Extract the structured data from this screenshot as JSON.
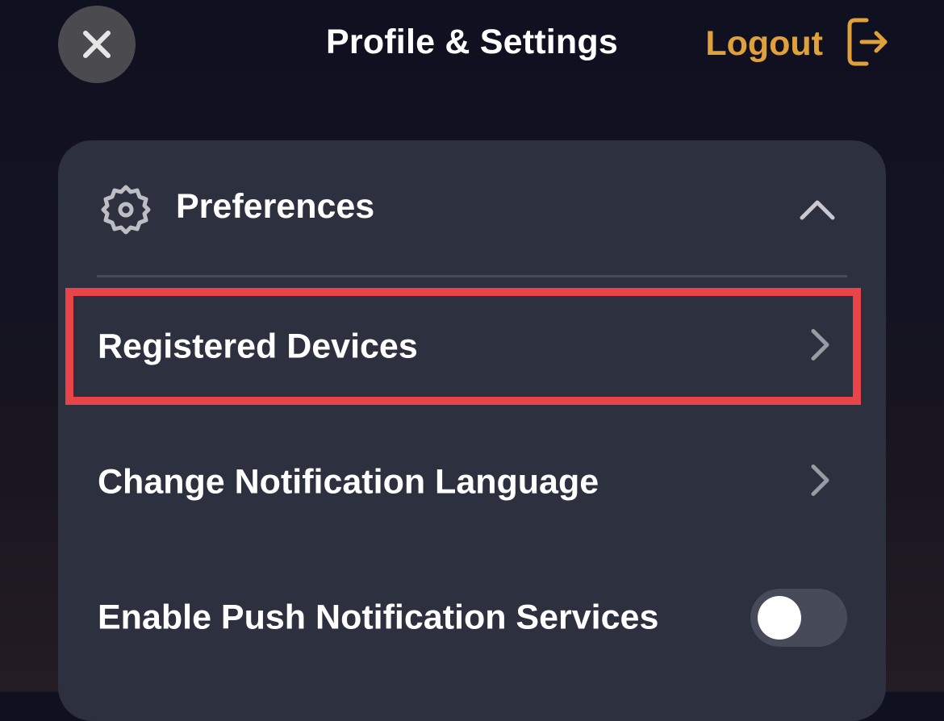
{
  "header": {
    "title": "Profile & Settings",
    "close_icon": "close-icon",
    "logout_label": "Logout",
    "logout_icon": "logout-icon"
  },
  "preferences": {
    "title": "Preferences",
    "icon": "gear-icon",
    "expanded": true,
    "items": [
      {
        "label": "Registered Devices",
        "type": "link",
        "highlighted": true
      },
      {
        "label": "Change Notification Language",
        "type": "link"
      },
      {
        "label": "Enable Push Notification Services",
        "type": "toggle",
        "value": false
      }
    ]
  },
  "colors": {
    "accent": "#e0a13a",
    "panel": "#2d303f",
    "highlight": "#e8444a"
  }
}
